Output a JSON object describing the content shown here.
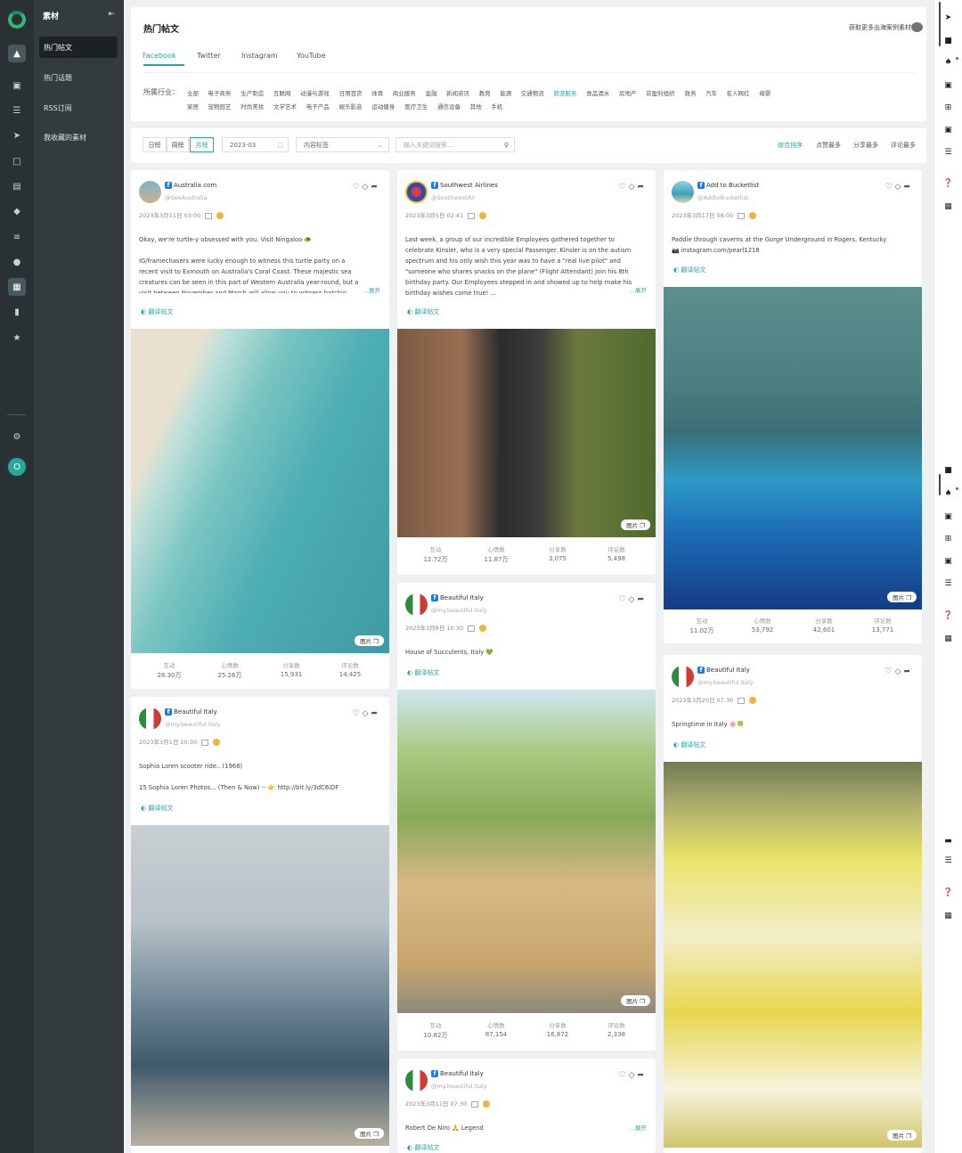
{
  "sidebar": {
    "title": "素材",
    "collapse_icon": "collapse-icon",
    "items": [
      {
        "label": "热门帖文",
        "active": true
      },
      {
        "label": "热门话题",
        "active": false
      },
      {
        "label": "RSS订阅",
        "active": false
      },
      {
        "label": "我收藏的素材",
        "active": false
      }
    ],
    "user_initial": "O"
  },
  "header": {
    "title": "热门帖文",
    "promo": "获取更多出海案例素材",
    "tabs": [
      "Facebook",
      "Twitter",
      "Instagram",
      "YouTube"
    ],
    "active_tab": "Facebook"
  },
  "industry": {
    "label": "所属行业：",
    "row1": [
      "全部",
      "电子商务",
      "生产制造",
      "互联网",
      "动漫与游戏",
      "日用百货",
      "体育",
      "商业服务",
      "金融",
      "新闻资讯",
      "教育",
      "能源",
      "交通物流",
      "旅游服务",
      "食品酒水",
      "房地产",
      "非盈利组织",
      "政务",
      "汽车",
      "名人网红",
      "母婴"
    ],
    "row2": [
      "家居",
      "宠物园艺",
      "时尚美妆",
      "文学艺术",
      "电子产品",
      "娱乐影音",
      "运动健身",
      "医疗卫生",
      "通信设备",
      "其他",
      "手机"
    ],
    "active": "旅游服务"
  },
  "filters": {
    "period": [
      "日榜",
      "周榜",
      "月榜"
    ],
    "active_period": "月榜",
    "month": "2023-03",
    "content_tag": "内容标签",
    "search_placeholder": "输入关键词搜索...",
    "sorts": [
      "综合排序",
      "点赞最多",
      "分享最多",
      "评论最多"
    ],
    "active_sort": "综合排序"
  },
  "labels": {
    "translate": "翻译帖文",
    "image": "图片",
    "expand": "...展开",
    "interact": "互动",
    "mood": "心情数",
    "share": "分享数",
    "comment": "评论数"
  },
  "posts": [
    {
      "name": "Australia.com",
      "handle": "@SeeAustralia",
      "date": "2023年3月11日 03:00",
      "text": "Okay, we're turtle-y obsessed with you. Visit Ningaloo 🐢\n\nIG/framechasers were lucky enough to witness this turtle party on a\nrecent visit to Exmouth on Australia's Coral Coast. These majestic sea\ncreatures can be seen in this part of Western Australia year-round, but a\nvisit between November and March will allow you to witness hatchin",
      "stats": [
        "28.30万",
        "25.26万",
        "15,931",
        "14,425"
      ]
    },
    {
      "name": "Southwest Airlines",
      "handle": "@SouthwestAir",
      "date": "2023年3月5日 02:41",
      "text": "Last week, a group of our incredible Employees gathered together to\ncelebrate Kinsler, who is a very special Passenger. Kinsler is on the autism\nspectrum and his only wish this year was to have a \"real live pilot\" and\n\"someone who shares snacks on the plane\" (Flight Attendant) join his 8th\nbirthday party. Our Employees stepped in and showed up to help make his\nbirthday wishes come true! ...",
      "stats": [
        "12.72万",
        "11.87万",
        "3,075",
        "5,498"
      ]
    },
    {
      "name": "Add to Bucketlist",
      "handle": "@AddtoBucketlist",
      "date": "2023年3月17日 08:00",
      "text": "Paddle through caverns at the Gorge Underground in Rogers, Kentucky\n📷 instagram.com/pearl1218",
      "stats": [
        "11.02万",
        "53,792",
        "42,601",
        "13,771"
      ]
    },
    {
      "name": "Beautiful Italy",
      "handle": "@my.beautiful.italy",
      "date": "2023年3月1日 10:30",
      "text": "Sophia Loren scooter ride.. (1968)\n\n15 Sophia Loren Photos... (Then & Now) -- 👉 http://bit.ly/3dC6iDF",
      "stats": []
    },
    {
      "name": "Beautiful Italy",
      "handle": "@my.beautiful.italy",
      "date": "2023年3月8日 10:30",
      "text": "House of Succulents, Italy 💚",
      "stats": [
        "10.82万",
        "87,154",
        "16,872",
        "2,338"
      ]
    },
    {
      "name": "Beautiful Italy",
      "handle": "@my.beautiful.italy",
      "date": "2023年3月20日 07:30",
      "text": "Springtime in Italy 🌸🍀",
      "stats": []
    },
    {
      "name": "Beautiful Italy",
      "handle": "@my.beautiful.italy",
      "date": "2023年3月11日 07:30",
      "text": "Robert De Niro 🙏 Legend",
      "stats": []
    }
  ],
  "colors": {
    "accent": "#2aa6a4",
    "rail": "#2a3134",
    "panel": "#333b3e",
    "facebook": "#1877f2"
  }
}
